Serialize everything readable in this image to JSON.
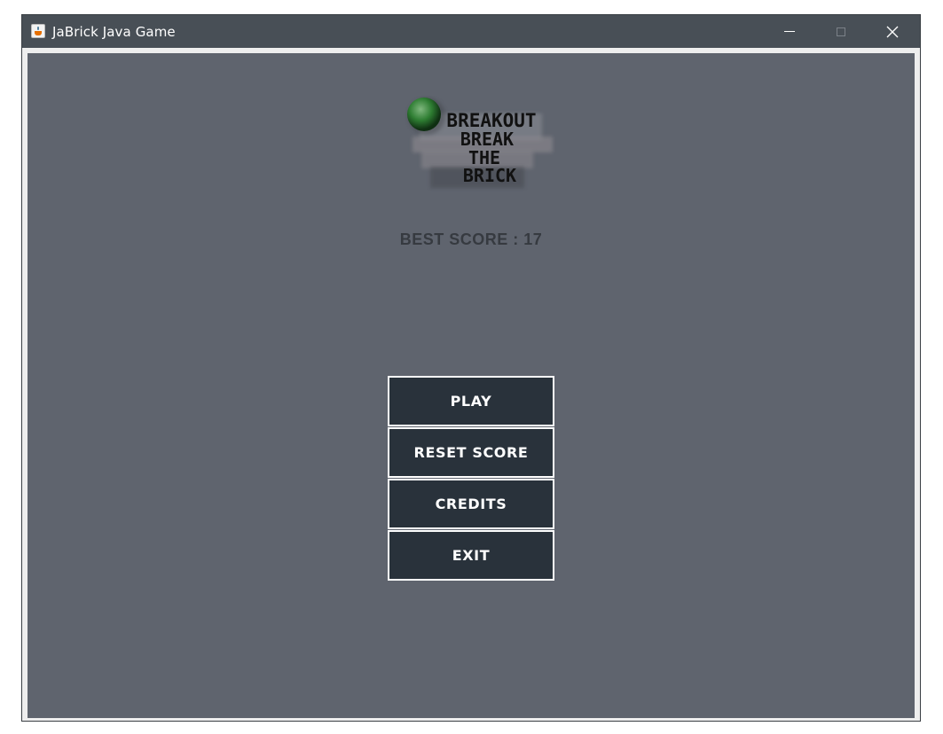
{
  "window": {
    "title": "JaBrick Java Game",
    "icon": "java-cup-icon",
    "controls": [
      "minimize-icon",
      "maximize-icon",
      "close-icon"
    ]
  },
  "logo": {
    "lines": [
      "BREAKOUT",
      "BREAK",
      "THE",
      "BRICK"
    ],
    "ball_color": "#2e7d32"
  },
  "best_score": {
    "text": "BEST SCORE : 17",
    "label": "BEST SCORE",
    "value": 17
  },
  "menu": {
    "play": "PLAY",
    "reset_score": "RESET SCORE",
    "credits": "CREDITS",
    "exit": "EXIT"
  },
  "colors": {
    "titlebar": "#484f56",
    "panel": "#5f646e",
    "button": "#29323b",
    "button_border": "#ffffff",
    "score_text": "#363a40"
  }
}
